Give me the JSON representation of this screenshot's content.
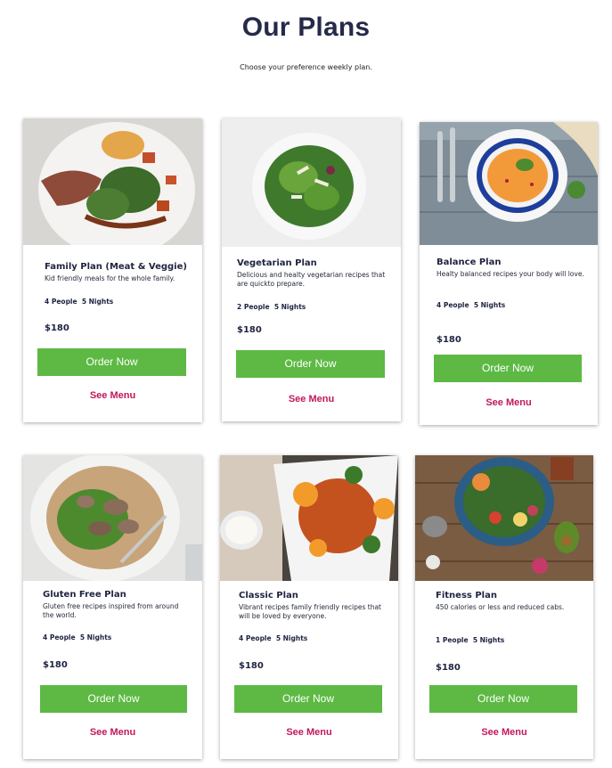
{
  "header": {
    "title": "Our Plans",
    "subtitle": "Choose your preference weekly plan."
  },
  "plans": [
    {
      "name": "Family Plan (Meat & Veggie)",
      "description": "Kid friendly meals for the whole family.",
      "people": "4 People",
      "nights": "5 Nights",
      "price": "$180",
      "order_label": "Order Now",
      "menu_label": "See Menu"
    },
    {
      "name": "Vegetarian Plan",
      "description": "Delicious and healty vegetarian recipes that are quickto prepare.",
      "people": "2 People",
      "nights": "5 Nights",
      "price": "$180",
      "order_label": "Order Now",
      "menu_label": "See Menu"
    },
    {
      "name": "Balance Plan",
      "description": "Healty balanced recipes your body will love.",
      "people": "4 People",
      "nights": "5 Nights",
      "price": "$180",
      "order_label": "Order Now",
      "menu_label": "See Menu"
    },
    {
      "name": "Gluten Free Plan",
      "description": "Gluten free recipes inspired from around the world.",
      "people": "4 People",
      "nights": "5 Nights",
      "price": "$180",
      "order_label": "Order Now",
      "menu_label": "See Menu"
    },
    {
      "name": "Classic Plan",
      "description": "Vibrant recipes family friendly recipes that will be loved by everyone.",
      "people": "4 People",
      "nights": "5 Nights",
      "price": "$180",
      "order_label": "Order Now",
      "menu_label": "See Menu"
    },
    {
      "name": "Fitness Plan",
      "description": "450 calories or less and reduced cabs.",
      "people": "1 People",
      "nights": "5 Nights",
      "price": "$180",
      "order_label": "Order Now",
      "menu_label": "See Menu"
    }
  ],
  "colors": {
    "accent_button": "#5db944",
    "menu_link": "#c2185b",
    "title": "#262a4a"
  }
}
